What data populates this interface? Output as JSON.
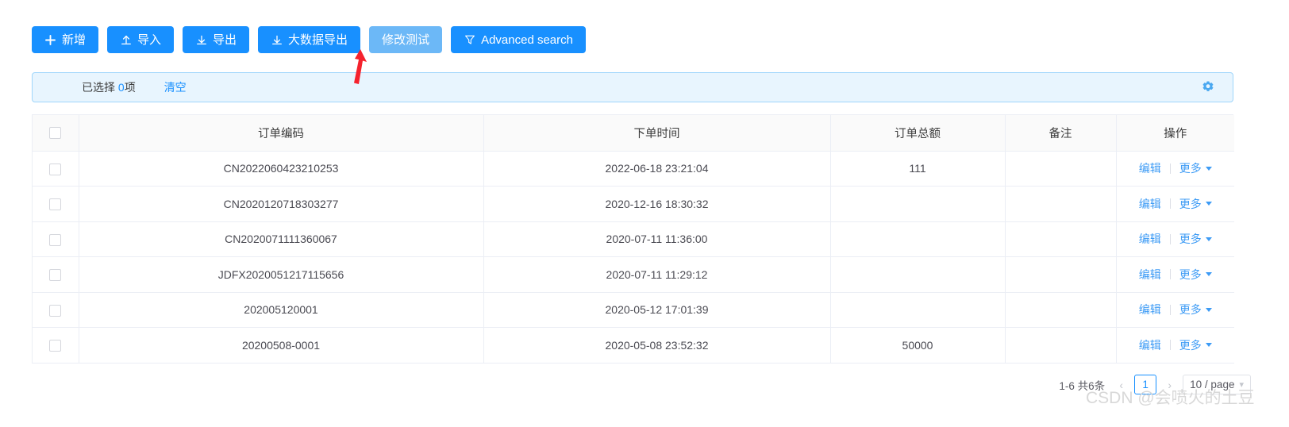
{
  "toolbar": {
    "buttons": [
      {
        "label": "新增",
        "icon": "plus-icon",
        "style": "primary"
      },
      {
        "label": "导入",
        "icon": "upload-icon",
        "style": "primary"
      },
      {
        "label": "导出",
        "icon": "download-icon",
        "style": "primary"
      },
      {
        "label": "大数据导出",
        "icon": "download-icon",
        "style": "primary"
      },
      {
        "label": "修改测试",
        "icon": "none",
        "style": "light"
      },
      {
        "label": "Advanced search",
        "icon": "filter-icon",
        "style": "primary"
      }
    ]
  },
  "selection_bar": {
    "prefix": "已选择 ",
    "count": "0",
    "suffix": "项",
    "clear_label": "清空",
    "settings_icon": "gear-icon"
  },
  "table": {
    "columns": [
      "",
      "订单编码",
      "下单时间",
      "订单总额",
      "备注",
      "操作"
    ],
    "rows": [
      {
        "order_no": "CN2022060423210253",
        "order_time": "2022-06-18 23:21:04",
        "amount": "111",
        "remark": ""
      },
      {
        "order_no": "CN2020120718303277",
        "order_time": "2020-12-16 18:30:32",
        "amount": "",
        "remark": ""
      },
      {
        "order_no": "CN2020071111360067",
        "order_time": "2020-07-11 11:36:00",
        "amount": "",
        "remark": ""
      },
      {
        "order_no": "JDFX2020051217115656",
        "order_time": "2020-07-11 11:29:12",
        "amount": "",
        "remark": ""
      },
      {
        "order_no": "202005120001",
        "order_time": "2020-05-12 17:01:39",
        "amount": "",
        "remark": ""
      },
      {
        "order_no": "20200508-0001",
        "order_time": "2020-05-08 23:52:32",
        "amount": "50000",
        "remark": ""
      }
    ],
    "actions": {
      "edit_label": "编辑",
      "more_label": "更多"
    }
  },
  "pagination": {
    "total_text": "1-6 共6条",
    "prev_icon": "chevron-left-icon",
    "current_page": "1",
    "next_icon": "chevron-right-icon",
    "page_size_label": "10 / page"
  },
  "annotation": {
    "arrow_color": "#f5222d"
  },
  "watermark": {
    "text": "CSDN @会喷火的土豆"
  },
  "colors": {
    "primary": "#1890ff",
    "primary_light": "#6cb8f7",
    "link": "#3d9bf5",
    "selbar_bg": "#e8f5fe",
    "selbar_border": "#9fd6fb",
    "header_bg": "#fafafa",
    "border": "#ebeef5"
  }
}
